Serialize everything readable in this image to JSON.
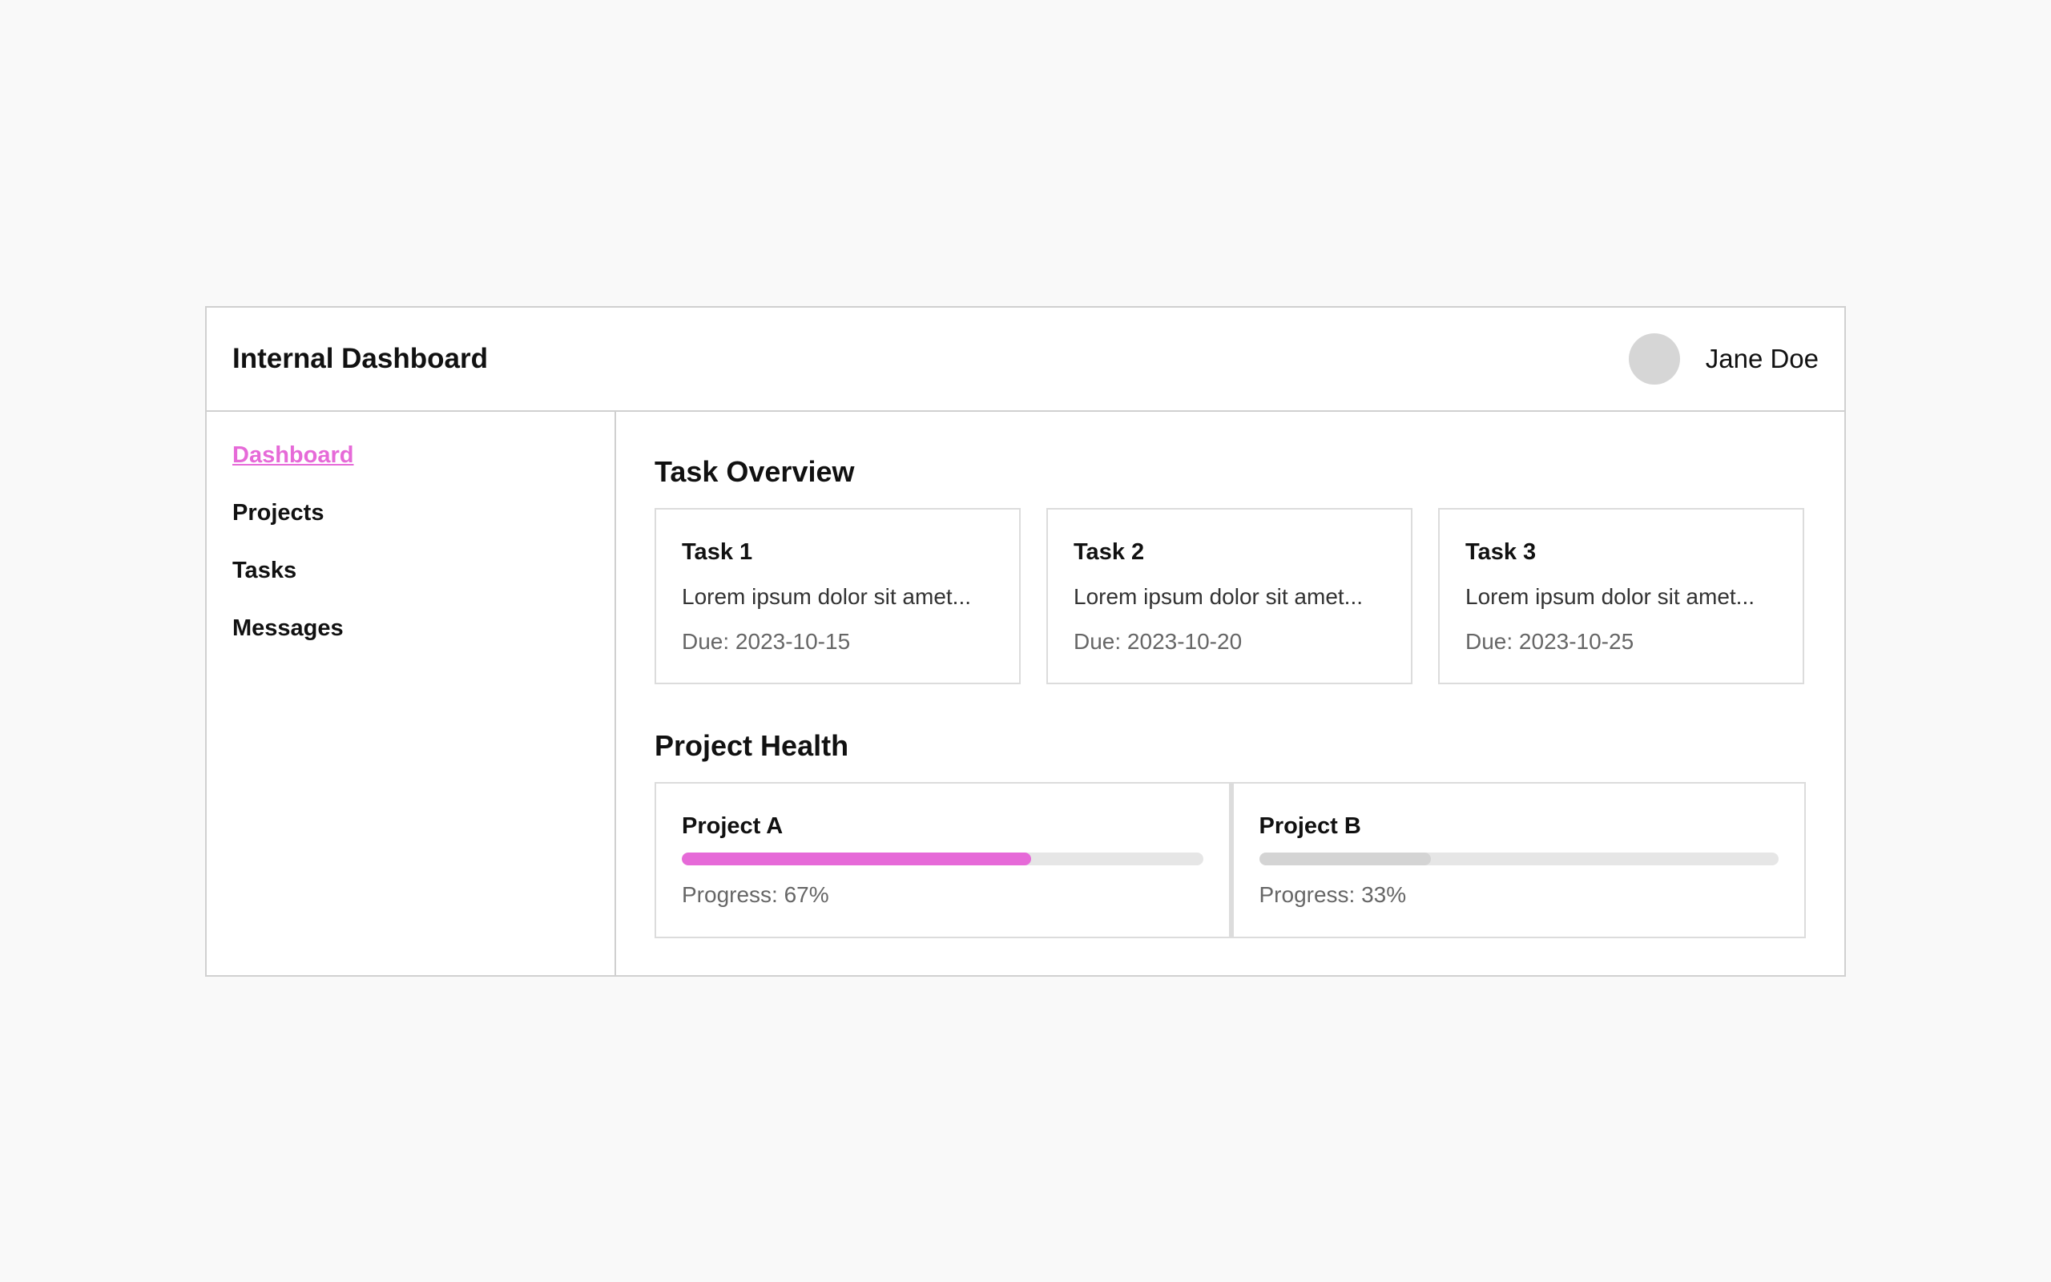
{
  "header": {
    "title": "Internal Dashboard",
    "user_name": "Jane Doe"
  },
  "sidebar": {
    "items": [
      {
        "label": "Dashboard",
        "active": true
      },
      {
        "label": "Projects",
        "active": false
      },
      {
        "label": "Tasks",
        "active": false
      },
      {
        "label": "Messages",
        "active": false
      }
    ]
  },
  "task_overview": {
    "title": "Task Overview",
    "tasks": [
      {
        "name": "Task 1",
        "description": "Lorem ipsum dolor sit amet...",
        "due": "Due: 2023-10-15"
      },
      {
        "name": "Task 2",
        "description": "Lorem ipsum dolor sit amet...",
        "due": "Due: 2023-10-20"
      },
      {
        "name": "Task 3",
        "description": "Lorem ipsum dolor sit amet...",
        "due": "Due: 2023-10-25"
      }
    ]
  },
  "project_health": {
    "title": "Project Health",
    "projects": [
      {
        "name": "Project A",
        "progress": 67,
        "progress_label": "Progress: 67%",
        "color": "#e66ad8"
      },
      {
        "name": "Project B",
        "progress": 33,
        "progress_label": "Progress: 33%",
        "color": "#d4d4d4"
      }
    ]
  },
  "colors": {
    "accent": "#e66ad8",
    "border": "#d0d0d0",
    "background": "#f9f9f9"
  }
}
